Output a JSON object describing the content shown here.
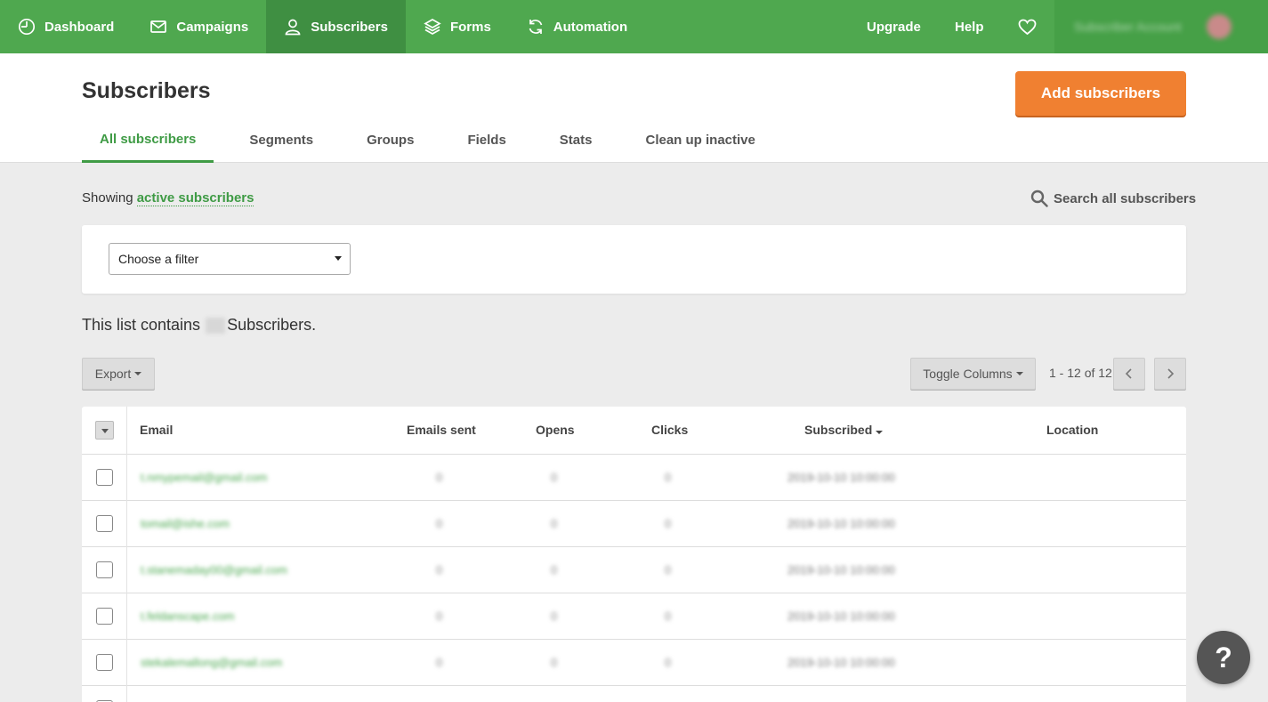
{
  "nav": {
    "items": [
      {
        "label": "Dashboard",
        "icon": "dashboard-icon"
      },
      {
        "label": "Campaigns",
        "icon": "envelope-icon"
      },
      {
        "label": "Subscribers",
        "icon": "user-icon"
      },
      {
        "label": "Forms",
        "icon": "layers-icon"
      },
      {
        "label": "Automation",
        "icon": "refresh-icon"
      }
    ],
    "upgrade": "Upgrade",
    "help": "Help",
    "account_name": "Subscriber Account"
  },
  "colors": {
    "brand_green": "#4fa84f",
    "active_nav": "#3f8f42",
    "accent_orange": "#f08031",
    "link_green": "#3f9b45"
  },
  "header": {
    "title": "Subscribers",
    "add_button": "Add subscribers",
    "tabs": [
      "All subscribers",
      "Segments",
      "Groups",
      "Fields",
      "Stats",
      "Clean up inactive"
    ]
  },
  "showing": {
    "prefix": "Showing",
    "link": "active subscribers"
  },
  "search": {
    "label": "Search all subscribers"
  },
  "filter": {
    "placeholder": "Choose a filter"
  },
  "list_count": {
    "prefix": "This list contains",
    "suffix": "Subscribers."
  },
  "toolbar": {
    "export": "Export",
    "toggle_columns": "Toggle Columns",
    "pager": "1 - 12 of 12"
  },
  "table": {
    "columns": [
      "Email",
      "Emails sent",
      "Opens",
      "Clicks",
      "Subscribed",
      "Location"
    ],
    "rows": [
      {
        "email": "t.nmypemail@gmail.com",
        "sent": "0",
        "opens": "0",
        "clicks": "0",
        "subscribed": "2019-10-10 10:00:00"
      },
      {
        "email": "tomail@ishe.com",
        "sent": "0",
        "opens": "0",
        "clicks": "0",
        "subscribed": "2019-10-10 10:00:00"
      },
      {
        "email": "t.stanemaday00@gmail.com",
        "sent": "0",
        "opens": "0",
        "clicks": "0",
        "subscribed": "2019-10-10 10:00:00"
      },
      {
        "email": "t.feldanscape.com",
        "sent": "0",
        "opens": "0",
        "clicks": "0",
        "subscribed": "2019-10-10 10:00:00"
      },
      {
        "email": "stekalemallong@gmail.com",
        "sent": "0",
        "opens": "0",
        "clicks": "0",
        "subscribed": "2019-10-10 10:00:00"
      }
    ]
  },
  "help_button": "?"
}
